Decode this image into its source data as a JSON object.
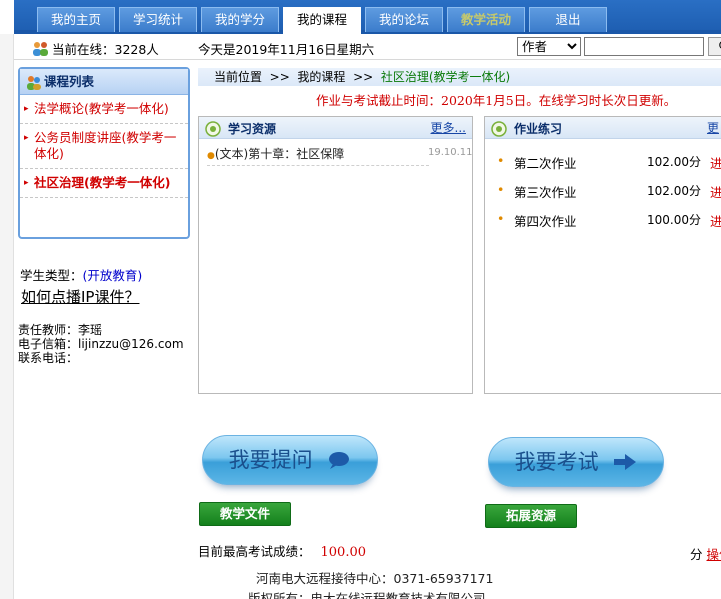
{
  "nav": {
    "tabs": [
      {
        "label": "我的主页"
      },
      {
        "label": "学习统计"
      },
      {
        "label": "我的学分"
      },
      {
        "label": "我的课程"
      },
      {
        "label": "我的论坛"
      },
      {
        "label": "教学活动"
      },
      {
        "label": "退出"
      }
    ],
    "active_tab": "我的课程"
  },
  "info": {
    "online_label": "当前在线：3228人",
    "date_text": "今天是2019年11月16日星期六",
    "search_select": "作者",
    "search_value": "",
    "search_button": "Q"
  },
  "sidebar": {
    "title": "课程列表",
    "courses": [
      {
        "label": "法学概论(教学考一体化)"
      },
      {
        "label": "公务员制度讲座(教学考一体化)"
      },
      {
        "label": "社区治理(教学考一体化)"
      }
    ],
    "student_type_label": "学生类型：",
    "student_type_value": "(开放教育)",
    "ip_help": "如何点播IP课件？",
    "teacher_label": "责任教师：",
    "teacher_name": "李瑶",
    "email_label": "电子信箱：",
    "email": "lijinzzu@126.com",
    "phone_label": "联系电话：",
    "phone": ""
  },
  "main": {
    "breadcrumb": {
      "prefix": "当前位置",
      "sep1": ">>",
      "level1": "我的课程",
      "sep2": ">>",
      "current": "社区治理(教学考一体化)"
    },
    "deadline": "作业与考试截止时间：2020年1月5日。在线学习时长次日更新。",
    "resources": {
      "title": "学习资源",
      "more": "更多...",
      "items": [
        {
          "title": "(文本)第十章：社区保障",
          "date": "19.10.11"
        }
      ]
    },
    "homework": {
      "title": "作业练习",
      "more": "更",
      "items": [
        {
          "name": "第二次作业",
          "score": "102.00分",
          "action": "进"
        },
        {
          "name": "第三次作业",
          "score": "102.00分",
          "action": "进"
        },
        {
          "name": "第四次作业",
          "score": "100.00分",
          "action": "进"
        }
      ]
    },
    "ask_button": "我要提问",
    "exam_button": "我要考试",
    "doc_button": "教学文件",
    "ext_button": "拓展资源",
    "score_label": "目前最高考试成绩：",
    "score_value": "100.00",
    "score_right_label": "分",
    "score_right_link": "操作"
  },
  "footer": {
    "line1": "河南电大远程接待中心：0371-65937171",
    "line2": "版权所有：电大在线远程教育技术有限公司"
  }
}
